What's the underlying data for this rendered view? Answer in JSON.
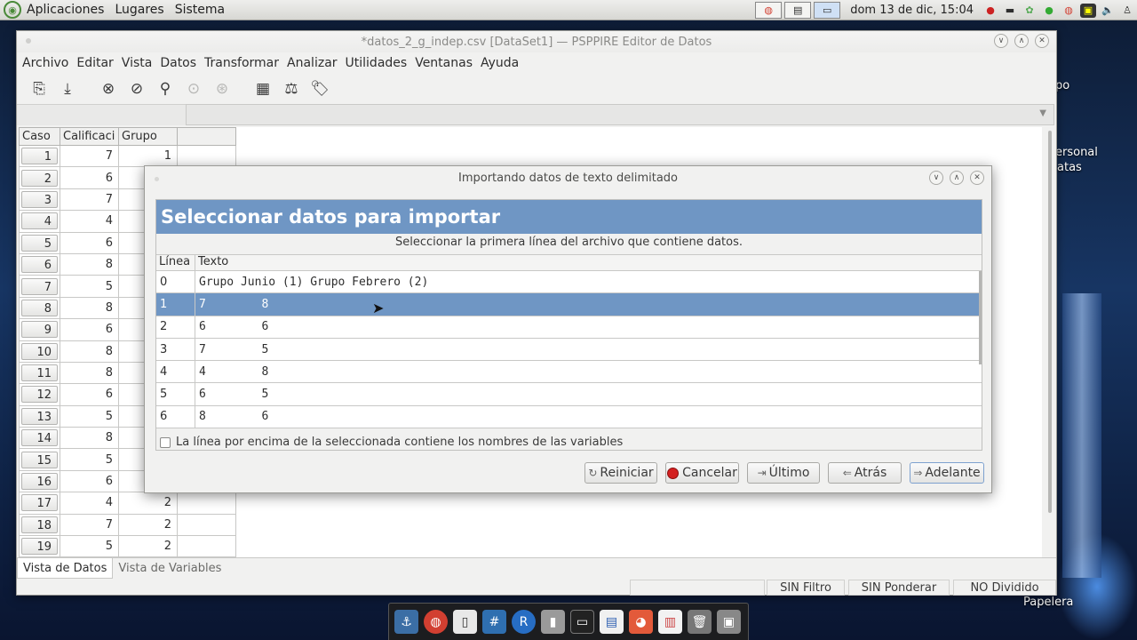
{
  "top_panel": {
    "menus": [
      "Aplicaciones",
      "Lugares",
      "Sistema"
    ],
    "clock": "dom 13 de dic, 15:04"
  },
  "desktop": {
    "label_1": "po",
    "label_2": "ersonal",
    "label_3": "atas",
    "trash_label": "Papelera"
  },
  "window": {
    "title": "*datos_2_g_indep.csv [DataSet1] — PSPPIRE Editor de Datos",
    "menu": [
      "Archivo",
      "Editar",
      "Vista",
      "Datos",
      "Transformar",
      "Analizar",
      "Utilidades",
      "Ventanas",
      "Ayuda"
    ],
    "columns": [
      "Caso",
      "Calificaci",
      "Grupo",
      ""
    ],
    "rows": [
      {
        "caso": "1",
        "calif": "7",
        "grupo": "1"
      },
      {
        "caso": "2",
        "calif": "6",
        "grupo": ""
      },
      {
        "caso": "3",
        "calif": "7",
        "grupo": ""
      },
      {
        "caso": "4",
        "calif": "4",
        "grupo": ""
      },
      {
        "caso": "5",
        "calif": "6",
        "grupo": ""
      },
      {
        "caso": "6",
        "calif": "8",
        "grupo": ""
      },
      {
        "caso": "7",
        "calif": "5",
        "grupo": ""
      },
      {
        "caso": "8",
        "calif": "8",
        "grupo": ""
      },
      {
        "caso": "9",
        "calif": "6",
        "grupo": ""
      },
      {
        "caso": "10",
        "calif": "8",
        "grupo": ""
      },
      {
        "caso": "11",
        "calif": "8",
        "grupo": ""
      },
      {
        "caso": "12",
        "calif": "6",
        "grupo": ""
      },
      {
        "caso": "13",
        "calif": "5",
        "grupo": ""
      },
      {
        "caso": "14",
        "calif": "8",
        "grupo": ""
      },
      {
        "caso": "15",
        "calif": "5",
        "grupo": ""
      },
      {
        "caso": "16",
        "calif": "6",
        "grupo": ""
      },
      {
        "caso": "17",
        "calif": "4",
        "grupo": "2"
      },
      {
        "caso": "18",
        "calif": "7",
        "grupo": "2"
      },
      {
        "caso": "19",
        "calif": "5",
        "grupo": "2"
      }
    ],
    "tabs": [
      "Vista de Datos",
      "Vista de Variables"
    ],
    "status": {
      "filter": "SIN Filtro",
      "weight": "SIN Ponderar",
      "split": "NO Dividido"
    }
  },
  "dialog": {
    "title": "Importando datos de texto delimitado",
    "heading": "Seleccionar datos para importar",
    "instruction": "Seleccionar la primera línea del archivo que contiene datos.",
    "col_line": "Línea",
    "col_text": "Texto",
    "lines": [
      {
        "n": "0",
        "text": "Grupo Junio (1) Grupo Febrero (2)"
      },
      {
        "n": "1",
        "text": "7        8"
      },
      {
        "n": "2",
        "text": "6        6"
      },
      {
        "n": "3",
        "text": "7        5"
      },
      {
        "n": "4",
        "text": "4        8"
      },
      {
        "n": "5",
        "text": "6        5"
      },
      {
        "n": "6",
        "text": "8        6"
      }
    ],
    "selected_line": "1",
    "checkbox_label": "La línea por encima de la seleccionada contiene los nombres de las variables",
    "buttons": {
      "reset": "Reiniciar",
      "cancel": "Cancelar",
      "last": "Último",
      "back": "Atrás",
      "next": "Adelante"
    }
  }
}
